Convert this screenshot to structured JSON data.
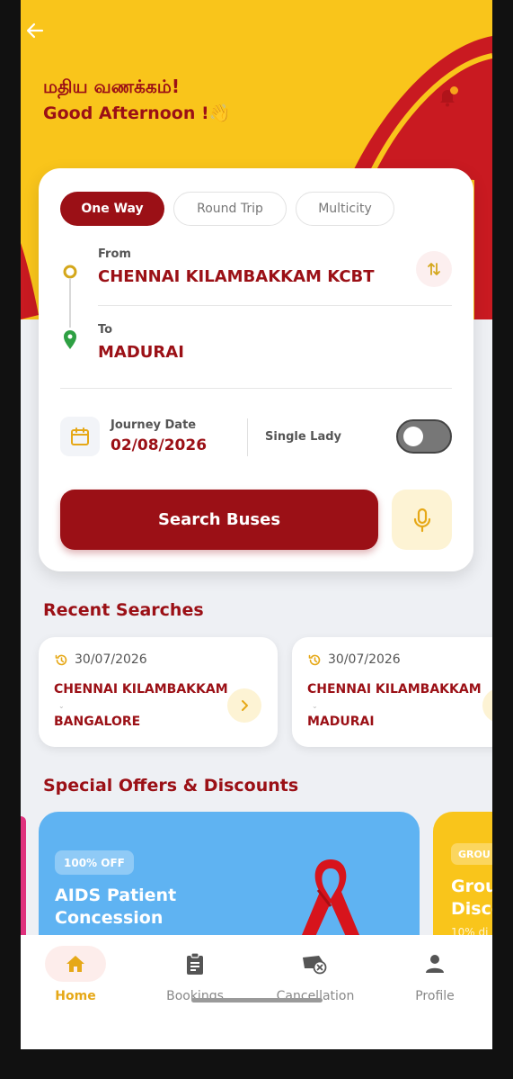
{
  "header": {
    "greeting_tamil": "மதிய வணக்கம்!",
    "greeting_english": "Good Afternoon !👋",
    "back_icon": "arrow-left-icon",
    "notification_icon": "bell-icon"
  },
  "booking": {
    "tabs": [
      "One Way",
      "Round Trip",
      "Multicity"
    ],
    "active_tab": "One Way",
    "from_label": "From",
    "from_value": "CHENNAI KILAMBAKKAM KCBT",
    "to_label": "To",
    "to_value": "MADURAI",
    "journey_date_label": "Journey Date",
    "journey_date_value": "02/08/2026",
    "single_lady_label": "Single Lady",
    "single_lady_on": false,
    "search_label": "Search Buses"
  },
  "recent": {
    "title": "Recent Searches",
    "items": [
      {
        "date": "30/07/2026",
        "from": "CHENNAI KILAMBAKKAM",
        "to": "BANGALORE"
      },
      {
        "date": "30/07/2026",
        "from": "CHENNAI KILAMBAKKAM",
        "to": "MADURAI"
      }
    ]
  },
  "offers": {
    "title": "Special Offers & Discounts",
    "items": [
      {
        "badge": "100% OFF",
        "title_line1": "AIDS Patient",
        "title_line2": "Concession"
      },
      {
        "badge": "GROU",
        "title_line1": "Grou",
        "title_line2": "Disco",
        "subtitle": "10% di"
      }
    ]
  },
  "nav": {
    "items": [
      {
        "label": "Home",
        "icon": "home-icon",
        "active": true
      },
      {
        "label": "Bookings",
        "icon": "clipboard-icon",
        "active": false
      },
      {
        "label": "Cancellation",
        "icon": "bus-cancel-icon",
        "active": false
      },
      {
        "label": "Profile",
        "icon": "person-icon",
        "active": false
      }
    ]
  },
  "colors": {
    "primary": "#9B1016",
    "accent_yellow": "#F9C51B",
    "offer_blue": "#5FB3F2",
    "success_green": "#2EA043"
  }
}
